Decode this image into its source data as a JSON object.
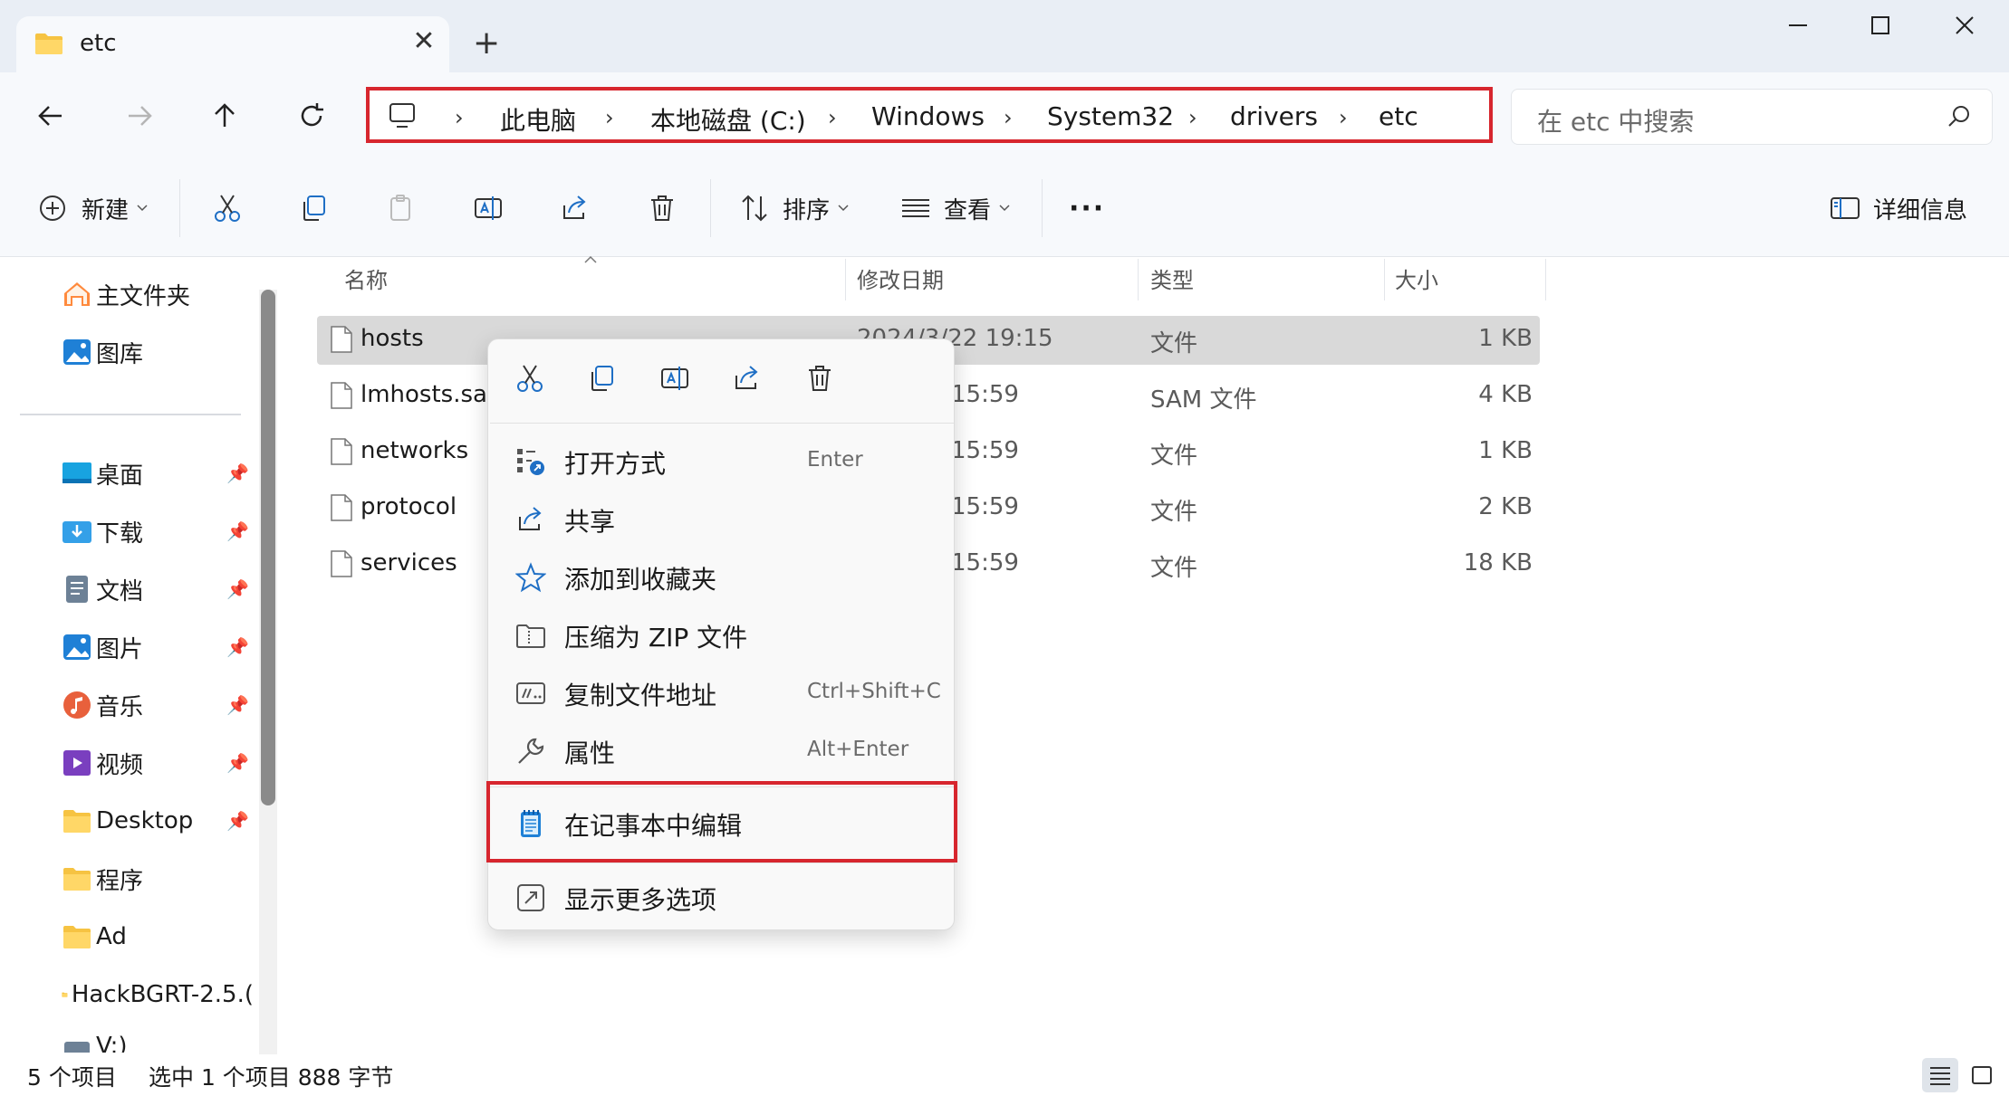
{
  "window": {
    "tab_title": "etc",
    "close_tab": "✕",
    "new_tab": "+"
  },
  "address": {
    "crumbs": [
      "此电脑",
      "本地磁盘 (C:)",
      "Windows",
      "System32",
      "drivers",
      "etc"
    ],
    "separator": "›"
  },
  "search": {
    "placeholder": "在 etc 中搜索"
  },
  "toolbar": {
    "new_label": "新建",
    "sort_label": "排序",
    "view_label": "查看",
    "more_label": "···",
    "details_label": "详细信息"
  },
  "sidebar": {
    "items": [
      {
        "label": "主文件夹",
        "pinned": false
      },
      {
        "label": "图库",
        "pinned": false
      },
      {
        "label": "桌面",
        "pinned": true
      },
      {
        "label": "下载",
        "pinned": true
      },
      {
        "label": "文档",
        "pinned": true
      },
      {
        "label": "图片",
        "pinned": true
      },
      {
        "label": "音乐",
        "pinned": true
      },
      {
        "label": "视频",
        "pinned": true
      },
      {
        "label": "Desktop",
        "pinned": true
      },
      {
        "label": "程序",
        "pinned": false
      },
      {
        "label": "Ad",
        "pinned": false
      },
      {
        "label": "HackBGRT-2.5.(",
        "pinned": false
      },
      {
        "label": "V:)",
        "pinned": false
      }
    ]
  },
  "columns": {
    "name": "名称",
    "modified": "修改日期",
    "type": "类型",
    "size": "大小"
  },
  "files": [
    {
      "name": "hosts",
      "modified": "2024/3/22 19:15",
      "type": "文件",
      "size": "1 KB",
      "selected": true
    },
    {
      "name": "lmhosts.sam",
      "modified": "15:59",
      "type": "SAM 文件",
      "size": "4 KB",
      "selected": false
    },
    {
      "name": "networks",
      "modified": "15:59",
      "type": "文件",
      "size": "1 KB",
      "selected": false
    },
    {
      "name": "protocol",
      "modified": "15:59",
      "type": "文件",
      "size": "2 KB",
      "selected": false
    },
    {
      "name": "services",
      "modified": "15:59",
      "type": "文件",
      "size": "18 KB",
      "selected": false
    }
  ],
  "context_menu": {
    "items": [
      {
        "label": "打开方式",
        "shortcut": "Enter",
        "icon": "open-with-icon"
      },
      {
        "label": "共享",
        "shortcut": "",
        "icon": "share-icon"
      },
      {
        "label": "添加到收藏夹",
        "shortcut": "",
        "icon": "star-icon"
      },
      {
        "label": "压缩为 ZIP 文件",
        "shortcut": "",
        "icon": "zip-icon"
      },
      {
        "label": "复制文件地址",
        "shortcut": "Ctrl+Shift+C",
        "icon": "copy-path-icon"
      },
      {
        "label": "属性",
        "shortcut": "Alt+Enter",
        "icon": "wrench-icon"
      }
    ],
    "highlighted": {
      "label": "在记事本中编辑",
      "icon": "notepad-icon"
    },
    "more": {
      "label": "显示更多选项",
      "icon": "more-options-icon"
    }
  },
  "status": {
    "count": "5 个项目",
    "selection": "选中 1 个项目  888 字节"
  },
  "colors": {
    "accent": "#0067c0",
    "highlight_border": "#d7262e",
    "selected_row": "#d9d9d9"
  }
}
